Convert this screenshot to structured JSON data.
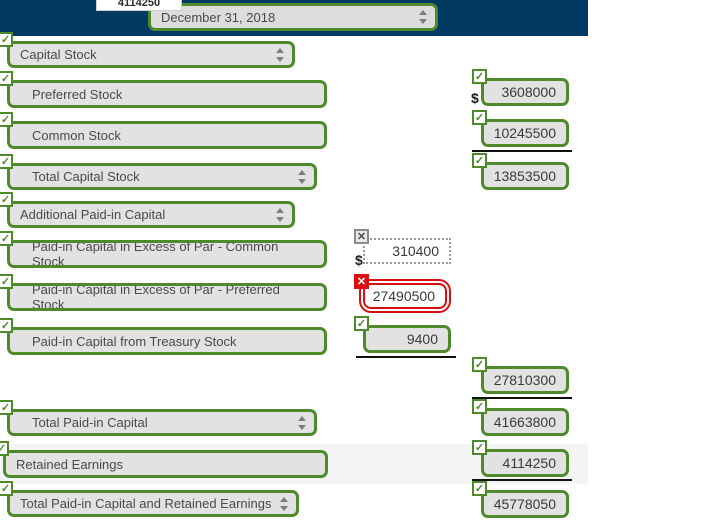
{
  "tooltip": {
    "text": "4114250"
  },
  "header": {
    "period_select": {
      "value": "December 31, 2018",
      "icon": "spinner-arrows-icon"
    }
  },
  "worksheet": {
    "rows": [
      {
        "key": "capital_stock_section",
        "label": "Capital Stock",
        "control": "select",
        "indent": 0,
        "status": "ok",
        "value": null
      },
      {
        "key": "preferred_stock",
        "label": "Preferred Stock",
        "control": "text",
        "indent": 1,
        "status": "ok",
        "value": "3608000",
        "value_status": "ok",
        "dollar": "$"
      },
      {
        "key": "common_stock",
        "label": "Common Stock",
        "control": "text",
        "indent": 1,
        "status": "ok",
        "value": "10245500",
        "value_status": "ok",
        "subtotal_rule": true
      },
      {
        "key": "total_capital_stock",
        "label": "Total Capital Stock",
        "control": "select",
        "indent": 1,
        "status": "ok",
        "value": "13853500",
        "value_status": "ok"
      },
      {
        "key": "additional_paid_in_capital_section",
        "label": "Additional Paid-in Capital",
        "control": "select",
        "indent": 0,
        "status": "ok",
        "value": null
      },
      {
        "key": "apic_excess_par_common",
        "label": "Paid-in Capital in Excess of Par - Common Stock",
        "control": "text",
        "indent": 1,
        "status": "ok",
        "value": "310400",
        "value_status": "disabled",
        "dollar": "$"
      },
      {
        "key": "apic_excess_par_preferred",
        "label": "Paid-in Capital in Excess of Par - Preferred Stock",
        "control": "text",
        "indent": 1,
        "status": "ok",
        "value": "27490500",
        "value_status": "error"
      },
      {
        "key": "apic_treasury_stock",
        "label": "Paid-in Capital from Treasury Stock",
        "control": "text",
        "indent": 1,
        "status": "ok",
        "value": "9400",
        "value_status": "ok",
        "subtotal_rule": true
      },
      {
        "key": "total_additional_paid_in_capital",
        "label": null,
        "control": null,
        "indent": 1,
        "status": null,
        "value": "27810300",
        "value_status": "ok",
        "subtotal_rule": true
      },
      {
        "key": "total_paid_in_capital",
        "label": "Total Paid-in Capital",
        "control": "select",
        "indent": 1,
        "status": "ok",
        "value": "41663800",
        "value_status": "ok"
      },
      {
        "key": "retained_earnings",
        "label": "Retained Earnings",
        "control": "text",
        "indent": 0,
        "status": "ok",
        "value": "4114250",
        "value_status": "ok",
        "highlighted": true,
        "subtotal_rule": true
      },
      {
        "key": "total_paid_in_and_retained",
        "label": "Total Paid-in Capital and Retained Earnings",
        "control": "select",
        "indent": 0,
        "status": "ok",
        "value": "45778050",
        "value_status": "ok"
      }
    ]
  },
  "status_badges": {
    "ok": "✓",
    "error": "✕",
    "disabled": "✕"
  },
  "colors": {
    "header_navy": "#003a63",
    "valid_green": "#4e8a2c",
    "error_red": "#d9100f",
    "disabled_gray": "#8a8a8a",
    "control_fill": "#e2e2e2",
    "highlight_stripe": "#f4f4f4"
  }
}
